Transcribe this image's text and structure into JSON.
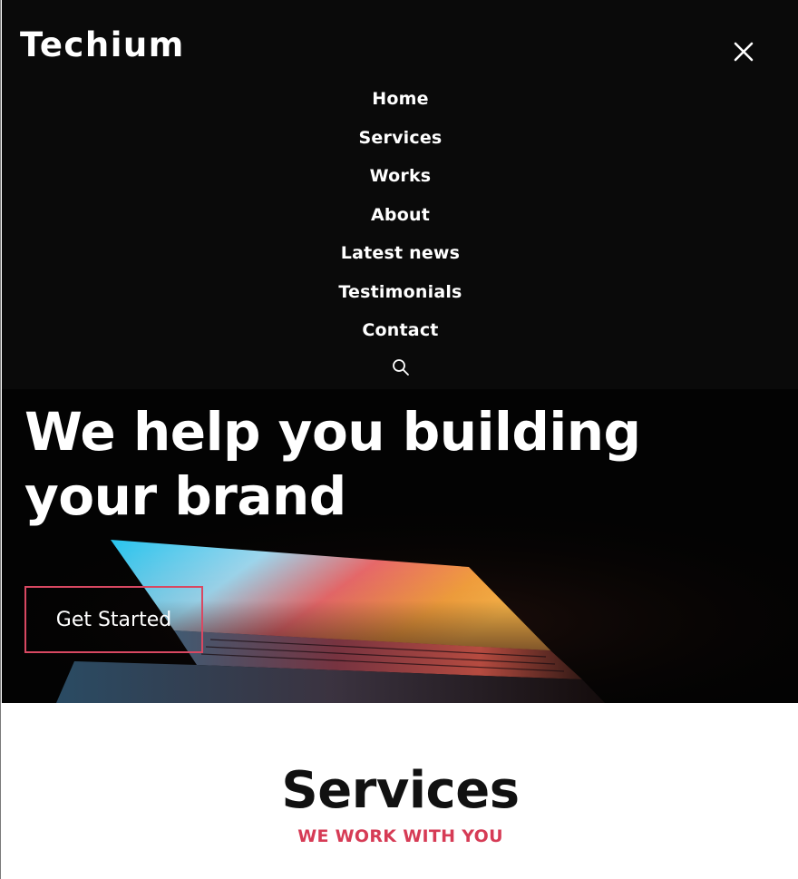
{
  "brand": {
    "logo_text": "Techium"
  },
  "nav": {
    "items": [
      {
        "label": "Home"
      },
      {
        "label": "Services"
      },
      {
        "label": "Works"
      },
      {
        "label": "About"
      },
      {
        "label": "Latest news"
      },
      {
        "label": "Testimonials"
      },
      {
        "label": "Contact"
      }
    ],
    "close_icon": "close-icon",
    "search_icon": "search-icon"
  },
  "hero": {
    "title": "We help you building your brand",
    "cta_label": "Get Started",
    "accent_color": "#d84862"
  },
  "services": {
    "title": "Services",
    "subtitle": "WE WORK WITH YOU",
    "subtitle_color": "#d63b55"
  }
}
